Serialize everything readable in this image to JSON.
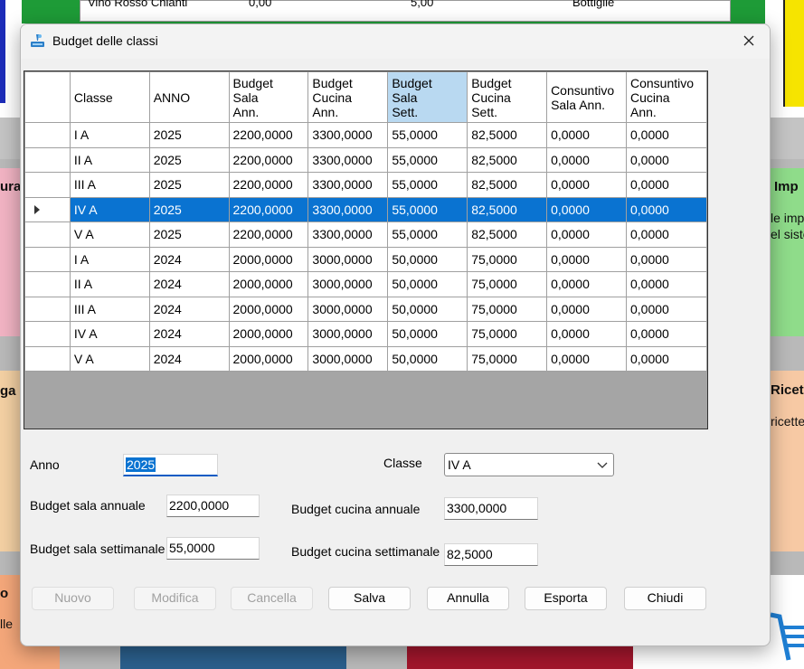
{
  "background": {
    "grid_row": {
      "col1": "Vino Rosso Chianti",
      "col2": "0,00",
      "col3": "5,00",
      "col4": "Bottiglie"
    },
    "left_card_1": "ura",
    "left_card_2": "ga",
    "left_card_3": "o",
    "left_card_3_sub": "lle",
    "right_card_1_title": "Imp",
    "right_card_1_line1": "le imp",
    "right_card_1_line2": "el siste",
    "right_card_2_title": "Ricet",
    "right_card_2_line1": "ricette"
  },
  "window": {
    "title": "Budget delle classi"
  },
  "grid": {
    "columns": [
      "Classe",
      "ANNO",
      "Budget\nSala\nAnn.",
      "Budget\nCucina\nAnn.",
      "Budget\nSala\nSett.",
      "Budget\nCucina\nSett.",
      "Consuntivo\nSala Ann.",
      "Consuntivo\nCucina\nAnn."
    ],
    "rows": [
      [
        "I A",
        "2025",
        "2200,0000",
        "3300,0000",
        "55,0000",
        "82,5000",
        "0,0000",
        "0,0000"
      ],
      [
        "II A",
        "2025",
        "2200,0000",
        "3300,0000",
        "55,0000",
        "82,5000",
        "0,0000",
        "0,0000"
      ],
      [
        "III A",
        "2025",
        "2200,0000",
        "3300,0000",
        "55,0000",
        "82,5000",
        "0,0000",
        "0,0000"
      ],
      [
        "IV A",
        "2025",
        "2200,0000",
        "3300,0000",
        "55,0000",
        "82,5000",
        "0,0000",
        "0,0000"
      ],
      [
        "V A",
        "2025",
        "2200,0000",
        "3300,0000",
        "55,0000",
        "82,5000",
        "0,0000",
        "0,0000"
      ],
      [
        "I A",
        "2024",
        "2000,0000",
        "3000,0000",
        "50,0000",
        "75,0000",
        "0,0000",
        "0,0000"
      ],
      [
        "II A",
        "2024",
        "2000,0000",
        "3000,0000",
        "50,0000",
        "75,0000",
        "0,0000",
        "0,0000"
      ],
      [
        "III A",
        "2024",
        "2000,0000",
        "3000,0000",
        "50,0000",
        "75,0000",
        "0,0000",
        "0,0000"
      ],
      [
        "IV A",
        "2024",
        "2000,0000",
        "3000,0000",
        "50,0000",
        "75,0000",
        "0,0000",
        "0,0000"
      ],
      [
        "V A",
        "2024",
        "2000,0000",
        "3000,0000",
        "50,0000",
        "75,0000",
        "0,0000",
        "0,0000"
      ]
    ],
    "selected_row": 3,
    "highlighted_column": 4
  },
  "form": {
    "anno_label": "Anno",
    "anno_value": "2025",
    "classe_label": "Classe",
    "classe_value": "IV A",
    "budget_sala_annuale_label": "Budget sala annuale",
    "budget_sala_annuale_value": "2200,0000",
    "budget_cucina_annuale_label": "Budget cucina annuale",
    "budget_cucina_annuale_value": "3300,0000",
    "budget_sala_settimanale_label": "Budget sala settimanale",
    "budget_sala_settimanale_value": "55,0000",
    "budget_cucina_settimanale_label": "Budget cucina settimanale",
    "budget_cucina_settimanale_value": "82,5000"
  },
  "buttons": {
    "nuovo": "Nuovo",
    "modifica": "Modifica",
    "cancella": "Cancella",
    "salva": "Salva",
    "annulla": "Annulla",
    "esporta": "Esporta",
    "chiudi": "Chiudi"
  },
  "colors": {
    "selection": "#0a73d1",
    "header_highlight": "#b9d9f1",
    "dialog_bg": "#f0f0f0"
  }
}
